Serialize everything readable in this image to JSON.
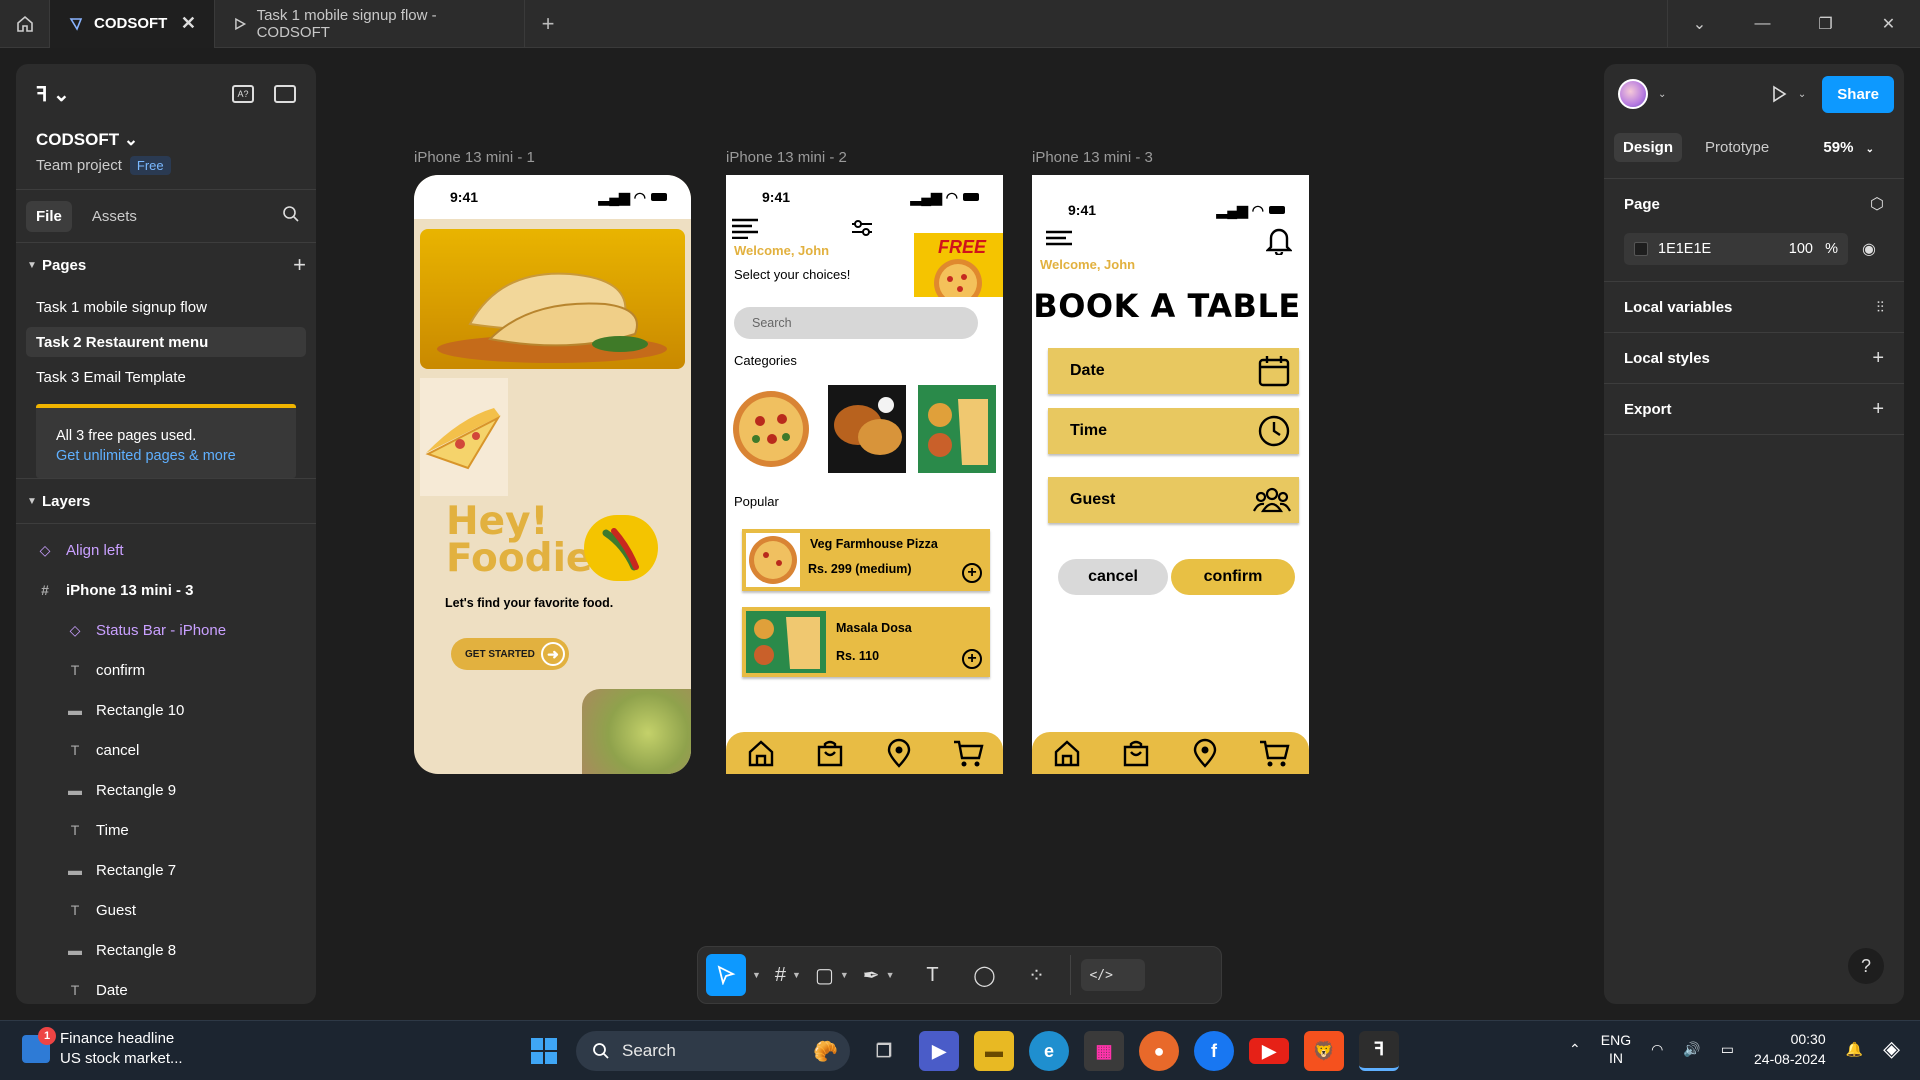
{
  "titlebar": {
    "tabs": [
      {
        "label": "CODSOFT",
        "active": true
      },
      {
        "label": "Task 1 mobile signup flow - CODSOFT",
        "active": false
      }
    ]
  },
  "left_panel": {
    "project_name": "CODSOFT",
    "project_type": "Team project",
    "plan_badge": "Free",
    "tabs": [
      "File",
      "Assets"
    ],
    "pages_header": "Pages",
    "pages": [
      {
        "label": "Task 1 mobile signup flow",
        "selected": false
      },
      {
        "label": "Task 2 Restaurent menu",
        "selected": true
      },
      {
        "label": "Task 3 Email Template",
        "selected": false
      }
    ],
    "upsell_text": "All 3 free pages used.",
    "upsell_link": "Get unlimited pages & more",
    "layers_header": "Layers",
    "layers": [
      {
        "label": "Align left",
        "kind": "component"
      },
      {
        "label": "iPhone 13 mini - 3",
        "kind": "frame"
      },
      {
        "label": "Status Bar - iPhone",
        "kind": "component"
      },
      {
        "label": "confirm",
        "kind": "text"
      },
      {
        "label": "Rectangle 10",
        "kind": "rect"
      },
      {
        "label": "cancel",
        "kind": "text"
      },
      {
        "label": "Rectangle 9",
        "kind": "rect"
      },
      {
        "label": "Time",
        "kind": "text"
      },
      {
        "label": "Rectangle 7",
        "kind": "rect"
      },
      {
        "label": "Guest",
        "kind": "text"
      },
      {
        "label": "Rectangle 8",
        "kind": "rect"
      },
      {
        "label": "Date",
        "kind": "text"
      }
    ]
  },
  "right_panel": {
    "share_label": "Share",
    "tabs": [
      "Design",
      "Prototype"
    ],
    "zoom": "59%",
    "page_label": "Page",
    "page_color": "1E1E1E",
    "page_opacity": "100",
    "page_opacity_unit": "%",
    "local_variables": "Local variables",
    "local_styles": "Local styles",
    "export": "Export",
    "help": "?"
  },
  "canvas": {
    "frame_labels": [
      "iPhone 13 mini - 1",
      "iPhone 13 mini - 2",
      "iPhone 13 mini - 3"
    ],
    "status_time": "9:41",
    "phone1": {
      "headline_1": "Hey!",
      "headline_2": "Foodie",
      "tagline": "Let's find your favorite food.",
      "cta": "GET STARTED"
    },
    "phone2": {
      "welcome": "Welcome, John",
      "subtitle": "Select your choices!",
      "ad_text": "FREE",
      "search_placeholder": "Search",
      "categories_label": "Categories",
      "popular_label": "Popular",
      "items": [
        {
          "name": "Veg Farmhouse Pizza",
          "price": "Rs. 299 (medium)"
        },
        {
          "name": "Masala Dosa",
          "price": "Rs. 110"
        }
      ]
    },
    "phone3": {
      "welcome": "Welcome, John",
      "title": "BOOK A TABLE",
      "fields": [
        "Date",
        "Time",
        "Guest"
      ],
      "cancel": "cancel",
      "confirm": "confirm"
    }
  },
  "taskbar": {
    "news_title": "Finance headline",
    "news_sub": "US stock market...",
    "news_badge": "1",
    "search": "Search",
    "lang_1": "ENG",
    "lang_2": "IN",
    "time": "00:30",
    "date": "24-08-2024"
  },
  "colors": {
    "canvas_bg": "#1E1E1E",
    "accent_blue": "#0d99ff",
    "brand_yellow": "#e8bc44"
  }
}
